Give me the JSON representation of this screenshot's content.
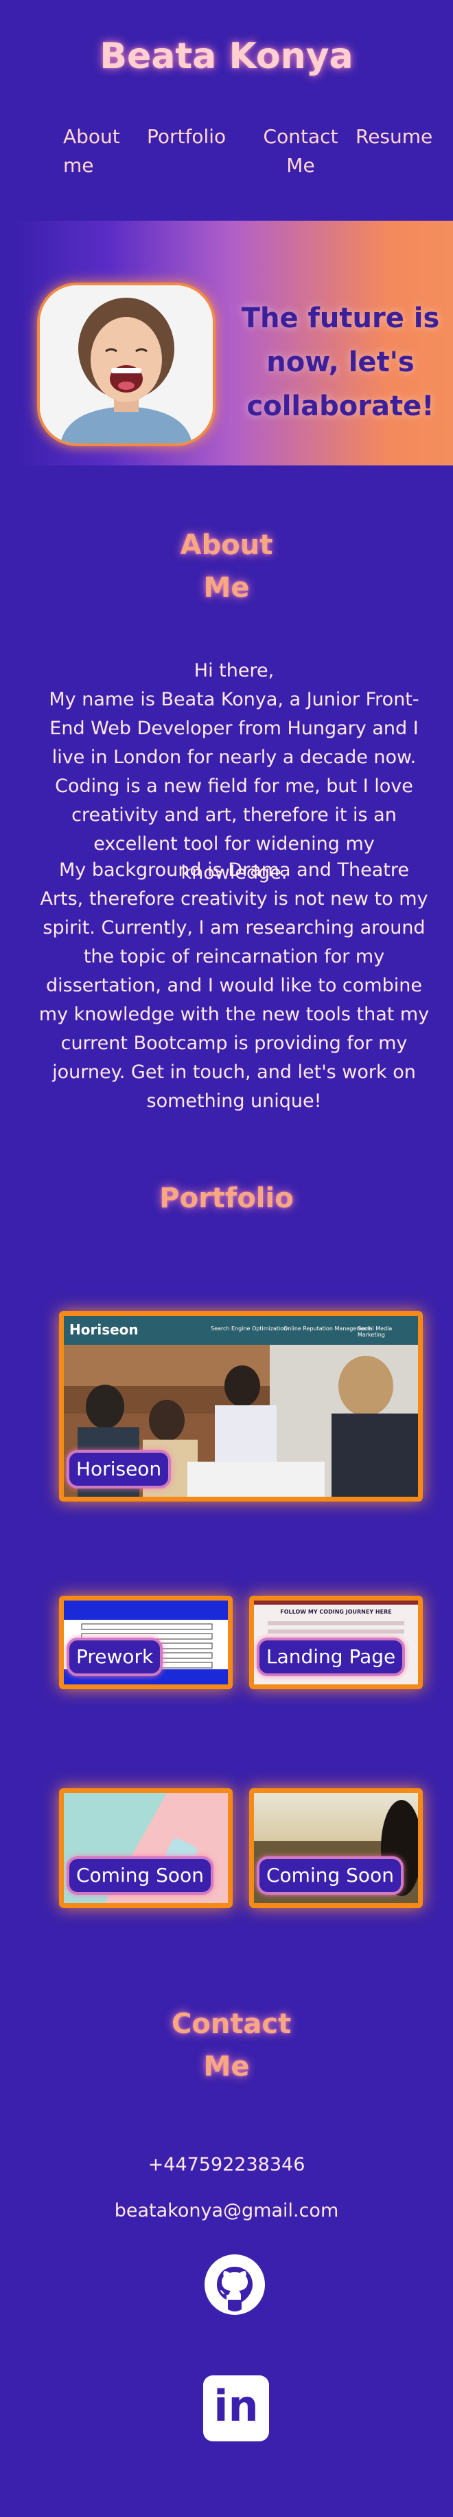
{
  "header": {
    "title": "Beata Konya",
    "nav": {
      "about": "About me",
      "portfolio": "Portfolio",
      "contact": "Contact Me",
      "resume": "Resume"
    }
  },
  "hero": {
    "tagline": "The future is now, let's collaborate!",
    "photo_icon": "smiling-woman-portrait"
  },
  "about": {
    "heading": "About Me",
    "greeting": "Hi there,",
    "paragraph1": "My name is Beata Konya, a Junior Front-End Web Developer from Hungary and I live in London for nearly a decade now. Coding is a new field for me, but I love creativity and art, therefore it is an excellent tool for widening my knowledge.",
    "paragraph2": "My background is Drama and Theatre Arts, therefore creativity is not new to my spirit. Currently, I am researching around the topic of reincarnation for my dissertation, and I would like to combine my knowledge with the new tools that my current Bootcamp is providing for my journey. Get in touch, and let's work on something unique!"
  },
  "portfolio": {
    "heading": "Portfolio",
    "featured": {
      "label": "Horiseon",
      "brand": "Horiseon",
      "nav_items": [
        "Search Engine Optimization",
        "Online Reputation Management",
        "Social Media Marketing"
      ]
    },
    "projects": [
      {
        "label": "Prework"
      },
      {
        "label": "Landing Page",
        "screenshot_title": "FOLLOW MY CODING JOURNEY HERE"
      },
      {
        "label": "Coming Soon"
      },
      {
        "label": "Coming Soon"
      }
    ]
  },
  "contact": {
    "heading": "Contact Me",
    "phone": "+447592238346",
    "email": "beatakonya@gmail.com",
    "github_icon": "github-icon",
    "linkedin_icon": "linkedin-icon",
    "linkedin_text": "in"
  },
  "colors": {
    "background": "#3a20ac",
    "accent_orange": "#f58a16",
    "heading_peach": "#f7a882",
    "tagline_purple": "#3c1f9a"
  }
}
